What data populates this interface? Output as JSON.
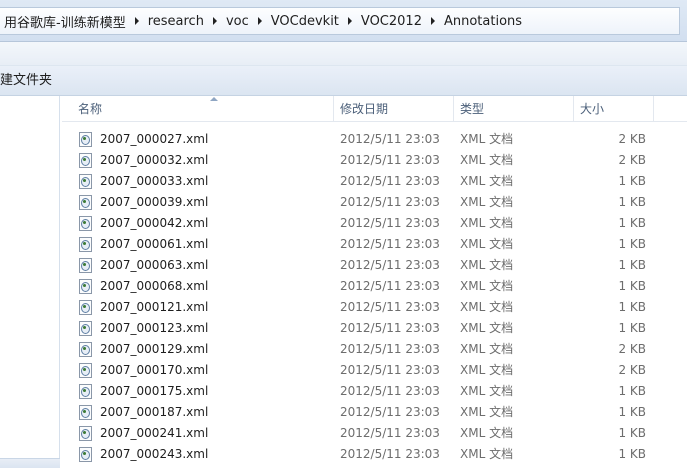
{
  "address": {
    "crumbs": [
      "用谷歌库-训练新模型",
      "research",
      "voc",
      "VOCdevkit",
      "VOC2012",
      "Annotations"
    ]
  },
  "toolbar": {
    "new_folder_label": "建文件夹"
  },
  "columns": {
    "name": "名称",
    "date": "修改日期",
    "type": "类型",
    "size": "大小"
  },
  "files": [
    {
      "name": "2007_000027.xml",
      "date": "2012/5/11 23:03",
      "type": "XML 文档",
      "size": "2 KB"
    },
    {
      "name": "2007_000032.xml",
      "date": "2012/5/11 23:03",
      "type": "XML 文档",
      "size": "2 KB"
    },
    {
      "name": "2007_000033.xml",
      "date": "2012/5/11 23:03",
      "type": "XML 文档",
      "size": "1 KB"
    },
    {
      "name": "2007_000039.xml",
      "date": "2012/5/11 23:03",
      "type": "XML 文档",
      "size": "1 KB"
    },
    {
      "name": "2007_000042.xml",
      "date": "2012/5/11 23:03",
      "type": "XML 文档",
      "size": "1 KB"
    },
    {
      "name": "2007_000061.xml",
      "date": "2012/5/11 23:03",
      "type": "XML 文档",
      "size": "1 KB"
    },
    {
      "name": "2007_000063.xml",
      "date": "2012/5/11 23:03",
      "type": "XML 文档",
      "size": "1 KB"
    },
    {
      "name": "2007_000068.xml",
      "date": "2012/5/11 23:03",
      "type": "XML 文档",
      "size": "1 KB"
    },
    {
      "name": "2007_000121.xml",
      "date": "2012/5/11 23:03",
      "type": "XML 文档",
      "size": "1 KB"
    },
    {
      "name": "2007_000123.xml",
      "date": "2012/5/11 23:03",
      "type": "XML 文档",
      "size": "1 KB"
    },
    {
      "name": "2007_000129.xml",
      "date": "2012/5/11 23:03",
      "type": "XML 文档",
      "size": "2 KB"
    },
    {
      "name": "2007_000170.xml",
      "date": "2012/5/11 23:03",
      "type": "XML 文档",
      "size": "2 KB"
    },
    {
      "name": "2007_000175.xml",
      "date": "2012/5/11 23:03",
      "type": "XML 文档",
      "size": "1 KB"
    },
    {
      "name": "2007_000187.xml",
      "date": "2012/5/11 23:03",
      "type": "XML 文档",
      "size": "1 KB"
    },
    {
      "name": "2007_000241.xml",
      "date": "2012/5/11 23:03",
      "type": "XML 文档",
      "size": "1 KB"
    },
    {
      "name": "2007_000243.xml",
      "date": "2012/5/11 23:03",
      "type": "XML 文档",
      "size": "1 KB"
    }
  ],
  "file_icon": "xml-document-icon"
}
